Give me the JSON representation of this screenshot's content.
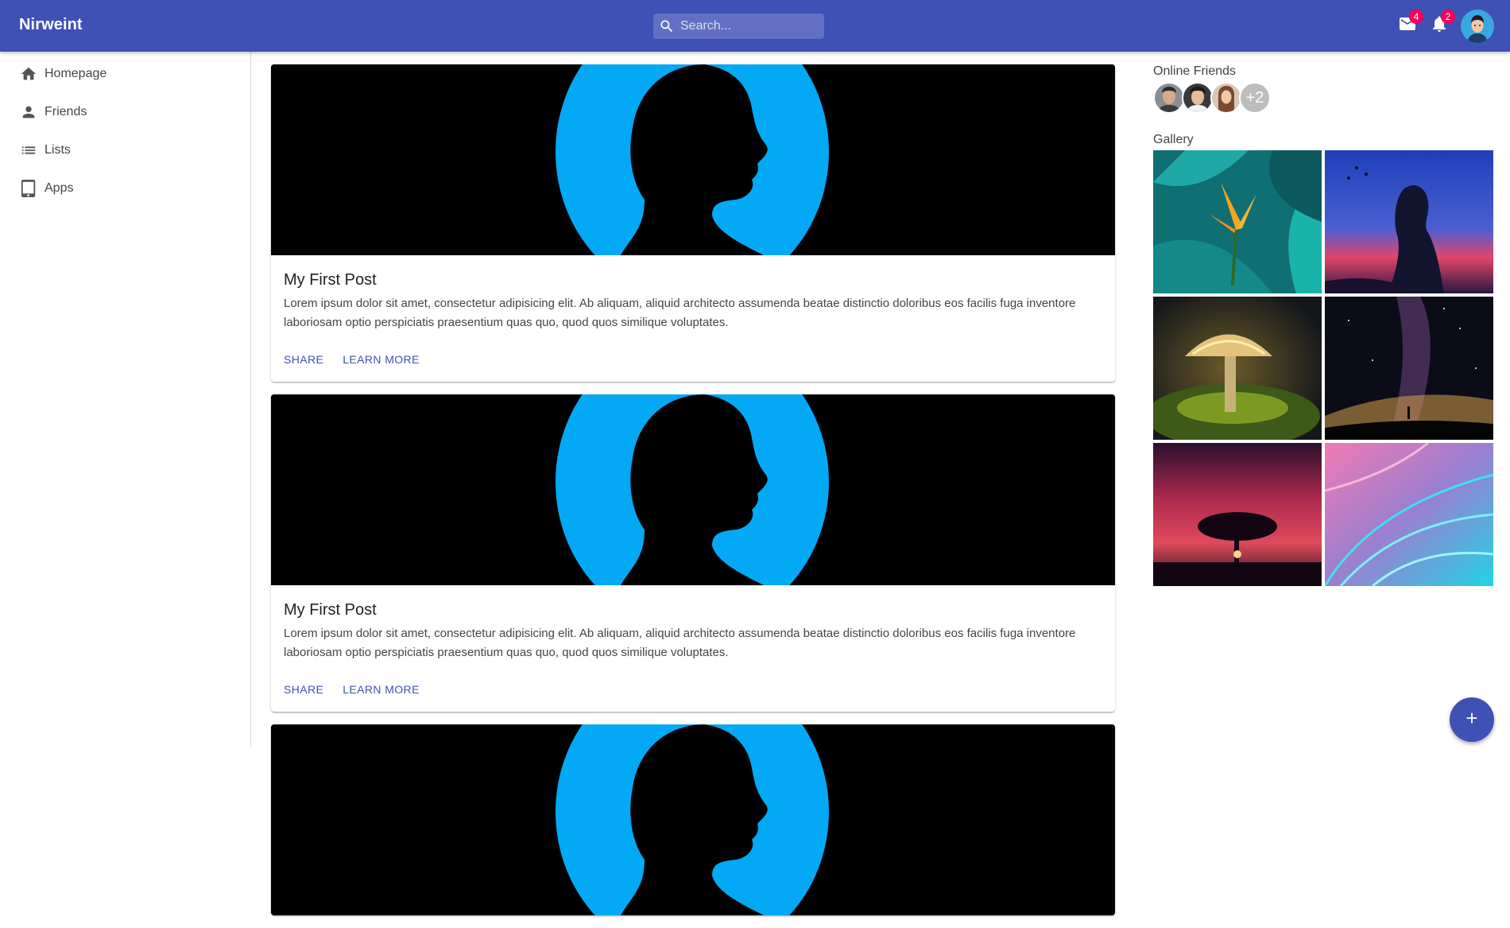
{
  "appbar": {
    "brand": "Nirweint",
    "search_placeholder": "Search...",
    "mail_badge": "4",
    "notifications_badge": "2"
  },
  "sidebar": {
    "items": [
      {
        "label": "Homepage",
        "icon": "home-icon"
      },
      {
        "label": "Friends",
        "icon": "person-icon"
      },
      {
        "label": "Lists",
        "icon": "list-icon"
      },
      {
        "label": "Apps",
        "icon": "tablet-icon"
      }
    ]
  },
  "feed": {
    "posts": [
      {
        "title": "My First Post",
        "body": "Lorem ipsum dolor sit amet, consectetur adipisicing elit. Ab aliquam, aliquid architecto assumenda beatae distinctio doloribus eos facilis fuga inventore laboriosam optio perspiciatis praesentium quas quo, quod quos similique voluptates.",
        "share": "SHARE",
        "learn_more": "LEARN MORE"
      },
      {
        "title": "My First Post",
        "body": "Lorem ipsum dolor sit amet, consectetur adipisicing elit. Ab aliquam, aliquid architecto assumenda beatae distinctio doloribus eos facilis fuga inventore laboriosam optio perspiciatis praesentium quas quo, quod quos similique voluptates.",
        "share": "SHARE",
        "learn_more": "LEARN MORE"
      }
    ]
  },
  "right": {
    "online_friends_title": "Online Friends",
    "more_friends": "+2",
    "gallery_title": "Gallery",
    "gallery": [
      "tropical-flower",
      "woman-silhouette-sunset",
      "glowing-mushroom",
      "milky-way-night",
      "tree-sunset",
      "pink-cyan-leaves"
    ]
  },
  "colors": {
    "primary": "#3f51b5",
    "badge": "#f50057",
    "hero_circle": "#03a9f4"
  }
}
